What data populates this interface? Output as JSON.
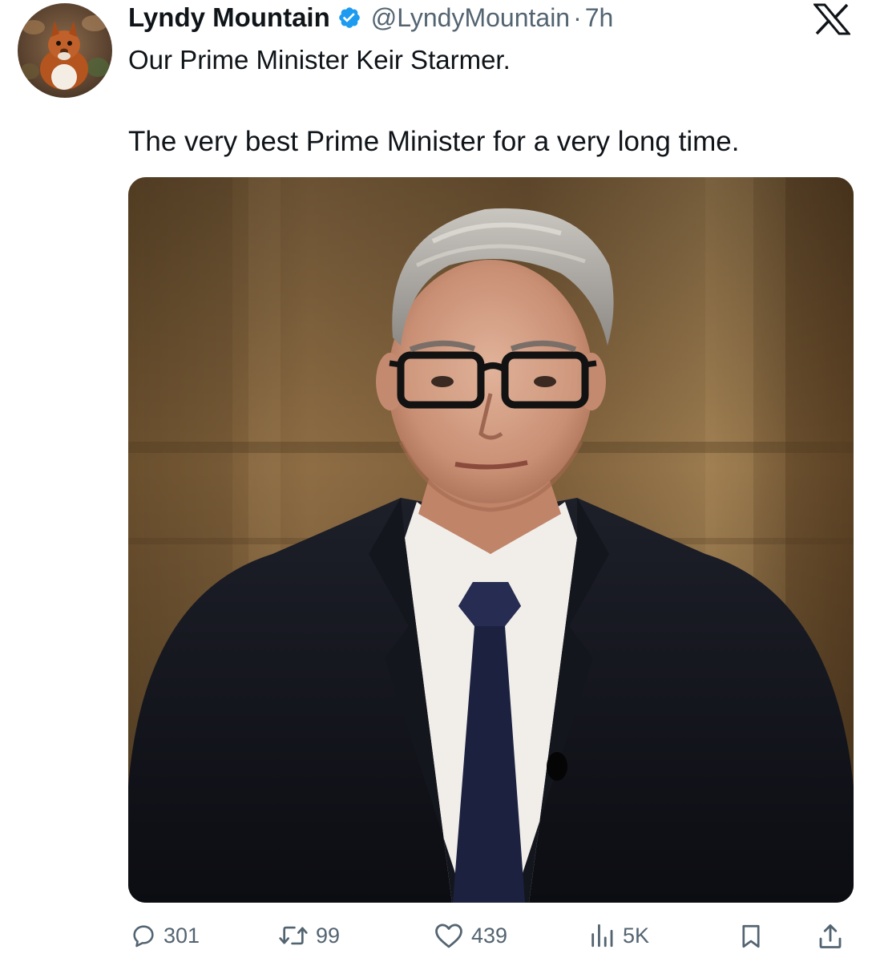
{
  "tweet": {
    "author": {
      "display_name": "Lyndy Mountain",
      "handle": "@LyndyMountain",
      "separator": "·",
      "time": "7h",
      "verified": true,
      "avatar_icon": "squirrel-avatar"
    },
    "text_lines": [
      "Our Prime Minister Keir Starmer.",
      "The very best Prime Minister for a very long time."
    ],
    "media": {
      "icon": "portrait-photo"
    },
    "stats": {
      "replies": "301",
      "reposts": "99",
      "likes": "439",
      "views": "5K"
    }
  },
  "colors": {
    "text": "#0f1419",
    "secondary": "#536471",
    "verified_blue": "#1d9bf0",
    "background": "#ffffff"
  }
}
